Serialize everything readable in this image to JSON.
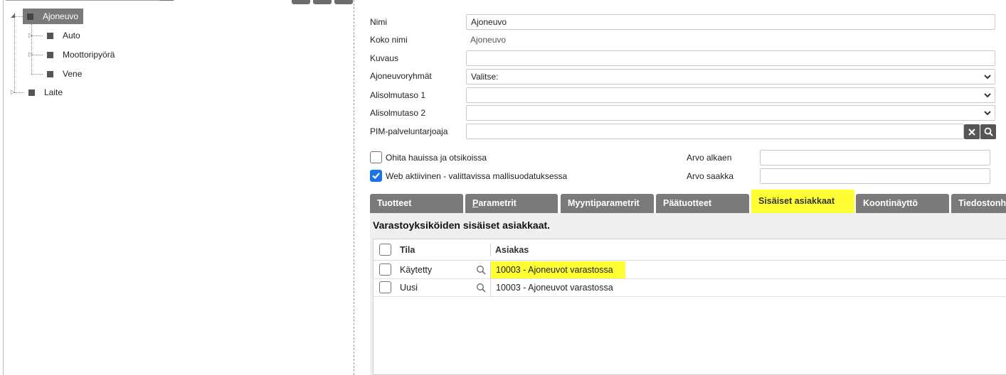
{
  "tree": {
    "nodes": [
      {
        "label": "Ajoneuvo"
      },
      {
        "label": "Auto"
      },
      {
        "label": "Moottoripyörä"
      },
      {
        "label": "Vene"
      },
      {
        "label": "Laite"
      }
    ]
  },
  "form": {
    "name_label": "Nimi",
    "name_value": "Ajoneuvo",
    "fullname_label": "Koko nimi",
    "fullname_value": "Ajoneuvo",
    "description_label": "Kuvaus",
    "description_value": "",
    "groups_label": "Ajoneuvoryhmät",
    "groups_value": "Valitse:",
    "sublevel1_label": "Alisolmutaso 1",
    "sublevel1_value": "",
    "sublevel2_label": "Alisolmutaso 2",
    "sublevel2_value": "",
    "pim_label": "PIM-palveluntarjoaja",
    "pim_value": "",
    "skip_search_label": "Ohita hauissa ja otsikoissa",
    "skip_search_checked": false,
    "web_active_label": "Web aktiivinen - valittavissa mallisuodatuksessa",
    "web_active_checked": true,
    "value_from_label": "Arvo alkaen",
    "value_from_value": "",
    "value_to_label": "Arvo saakka",
    "value_to_value": ""
  },
  "tabs": [
    {
      "label": "Tuotteet"
    },
    {
      "label": "Parametrit",
      "underline": "P",
      "rest": "arametrit"
    },
    {
      "label": "Myyntiparametrit"
    },
    {
      "label": "Päätuotteet"
    },
    {
      "label": "Sisäiset asiakkaat"
    },
    {
      "label": "Koontinäyttö"
    },
    {
      "label": "Tiedostonhallinta"
    }
  ],
  "content": {
    "title": "Varastoyksiköiden sisäiset asiakkaat.",
    "columns": {
      "status": "Tila",
      "customer": "Asiakas"
    },
    "rows": [
      {
        "status": "Käytetty",
        "customer": "10003 - Ajoneuvot varastossa"
      },
      {
        "status": "Uusi",
        "customer": "10003 - Ajoneuvot varastossa"
      }
    ]
  },
  "colors": {
    "highlight": "#ffff33",
    "tab_bg": "#7a7a7a",
    "checkbox_checked": "#1a73e8"
  }
}
